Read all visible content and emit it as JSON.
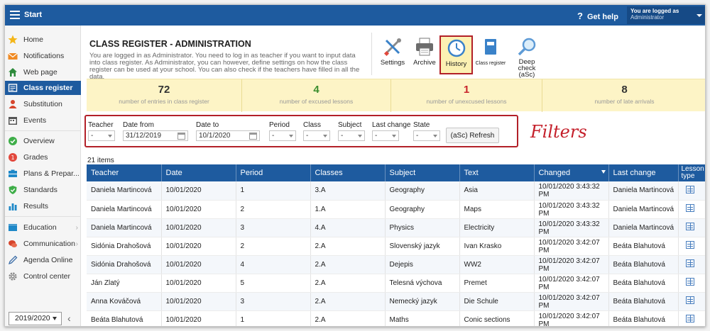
{
  "topbar": {
    "start": "Start",
    "help": "Get help",
    "logged_line1": "You are logged as",
    "logged_line2": "Administrator"
  },
  "sidebar": {
    "items": [
      {
        "label": "Home",
        "icon": "star-icon",
        "color": "#f4b619"
      },
      {
        "label": "Notifications",
        "icon": "envelope-icon",
        "color": "#f08a24"
      },
      {
        "label": "Web page",
        "icon": "house-icon",
        "color": "#2e8b3c"
      },
      {
        "label": "Class register",
        "icon": "register-icon",
        "color": "#ffffff",
        "active": true
      },
      {
        "label": "Substitution",
        "icon": "person-icon",
        "color": "#d6452c"
      },
      {
        "label": "Events",
        "icon": "calendar-icon",
        "color": "#555555"
      },
      {
        "label": "Overview",
        "icon": "check-circle-icon",
        "color": "#3fae49"
      },
      {
        "label": "Grades",
        "icon": "grades-icon",
        "color": "#e2483d"
      },
      {
        "label": "Plans & Prepar...",
        "icon": "plans-icon",
        "color": "#1e88c8"
      },
      {
        "label": "Standards",
        "icon": "shield-icon",
        "color": "#3fae49"
      },
      {
        "label": "Results",
        "icon": "bar-chart-icon",
        "color": "#1e88c8"
      },
      {
        "label": "Education",
        "icon": "education-icon",
        "color": "#1e88c8",
        "expandable": true
      },
      {
        "label": "Communication",
        "icon": "chat-icon",
        "color": "#d6452c",
        "expandable": true
      },
      {
        "label": "Agenda Online",
        "icon": "pen-icon",
        "color": "#3c6ea8"
      },
      {
        "label": "Control center",
        "icon": "gear-icon",
        "color": "#8a8a8a"
      }
    ],
    "year": "2019/2020"
  },
  "header": {
    "title": "CLASS REGISTER - ADMINISTRATION",
    "description": "You are logged in as Administrator. You need to log in as teacher if you want to input data into class register. As Administrator, you can however, define settings on how the class register can be used at your school. You can also check if the teachers have filled in all the data."
  },
  "toolbar": {
    "settings": "Settings",
    "archive": "Archive",
    "history": "History",
    "class_register": "Class register",
    "deep_check_line1": "Deep check",
    "deep_check_line2": "(aSc)"
  },
  "stats": [
    {
      "value": "72",
      "caption": "number of entries in class register",
      "color": "#333333"
    },
    {
      "value": "4",
      "caption": "number of excused lessons",
      "color": "#3b8d2e"
    },
    {
      "value": "1",
      "caption": "number of unexcused lessons",
      "color": "#c8242b"
    },
    {
      "value": "8",
      "caption": "number of late arrivals",
      "color": "#333333"
    }
  ],
  "filters": {
    "teacher_label": "Teacher",
    "teacher_value": "-",
    "date_from_label": "Date from",
    "date_from_value": "31/12/2019",
    "date_to_label": "Date to",
    "date_to_value": "10/1/2020",
    "period_label": "Period",
    "period_value": "-",
    "class_label": "Class",
    "class_value": "-",
    "subject_label": "Subject",
    "subject_value": "-",
    "last_change_label": "Last change",
    "last_change_value": "-",
    "state_label": "State",
    "state_value": "-",
    "refresh": "(aSc) Refresh"
  },
  "annotation": "Filters",
  "table": {
    "count": "21 items",
    "headers": [
      "Teacher",
      "Date",
      "Period",
      "Classes",
      "Subject",
      "Text",
      "Changed",
      "Last change",
      "Lesson type"
    ],
    "rows": [
      [
        "Daniela Martincová",
        "10/01/2020",
        "1",
        "3.A",
        "Geography",
        "Asia",
        "10/01/2020 3:43:32 PM",
        "Daniela Martincová"
      ],
      [
        "Daniela Martincová",
        "10/01/2020",
        "2",
        "1.A",
        "Geography",
        "Maps",
        "10/01/2020 3:43:32 PM",
        "Daniela Martincová"
      ],
      [
        "Daniela Martincová",
        "10/01/2020",
        "3",
        "4.A",
        "Physics",
        "Electricity",
        "10/01/2020 3:43:32 PM",
        "Daniela Martincová"
      ],
      [
        "Sidónia Drahošová",
        "10/01/2020",
        "2",
        "2.A",
        "Slovenský jazyk",
        "Ivan Krasko",
        "10/01/2020 3:42:07 PM",
        "Beáta Blahutová"
      ],
      [
        "Sidónia Drahošová",
        "10/01/2020",
        "4",
        "2.A",
        "Dejepis",
        "WW2",
        "10/01/2020 3:42:07 PM",
        "Beáta Blahutová"
      ],
      [
        "Ján Zlatý",
        "10/01/2020",
        "5",
        "2.A",
        "Telesná výchova",
        "Premet",
        "10/01/2020 3:42:07 PM",
        "Beáta Blahutová"
      ],
      [
        "Anna Kováčová",
        "10/01/2020",
        "3",
        "2.A",
        "Nemecký jazyk",
        "Die Schule",
        "10/01/2020 3:42:07 PM",
        "Beáta Blahutová"
      ],
      [
        "Beáta Blahutová",
        "10/01/2020",
        "1",
        "2.A",
        "Maths",
        "Conic sections",
        "10/01/2020 3:42:07 PM",
        "Beáta Blahutová"
      ]
    ]
  }
}
